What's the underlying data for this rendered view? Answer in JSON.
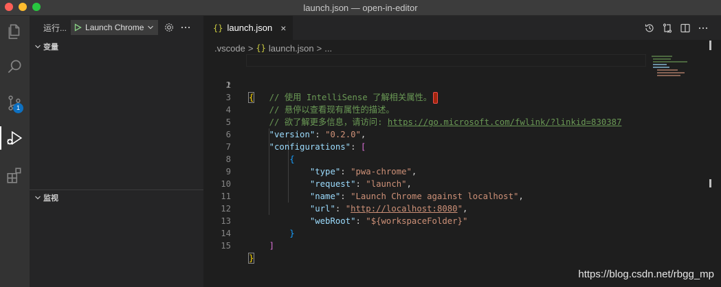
{
  "window": {
    "title": "launch.json — open-in-editor",
    "traffic_colors": [
      "#fe5f57",
      "#febc2e",
      "#28c840"
    ]
  },
  "activity_bar": {
    "badge_count": "1",
    "icons": [
      "files-icon",
      "search-icon",
      "source-control-icon",
      "run-debug-icon",
      "extensions-icon"
    ]
  },
  "sidebar": {
    "run_label": "运行...",
    "config_name": "Launch Chrome",
    "sections": {
      "variables": "变量",
      "watch": "监视"
    }
  },
  "editor": {
    "tab": {
      "icon_text": "{}",
      "label": "launch.json",
      "close": "×"
    },
    "breadcrumb": {
      "folder": ".vscode",
      "sep": ">",
      "file_icon": "{}",
      "file": "launch.json",
      "tail": "..."
    },
    "line_numbers": [
      "1",
      "2",
      "3",
      "4",
      "5",
      "6",
      "7",
      "8",
      "9",
      "10",
      "11",
      "12",
      "13",
      "14",
      "15"
    ],
    "code": {
      "l1_open": "{",
      "l2_comment": "// 使用 IntelliSense 了解相关属性。",
      "l3_comment": "// 悬停以查看现有属性的描述。",
      "l4_comment": "// 欲了解更多信息，请访问: ",
      "l4_link": "https://go.microsoft.com/fwlink/?linkid=830387",
      "version_key": "\"version\"",
      "version_val": "\"0.2.0\"",
      "configurations_key": "\"configurations\"",
      "arr_open": "[",
      "obj_open": "{",
      "type_key": "\"type\"",
      "type_val": "\"pwa-chrome\"",
      "request_key": "\"request\"",
      "request_val": "\"launch\"",
      "name_key": "\"name\"",
      "name_val": "\"Launch Chrome against localhost\"",
      "url_key": "\"url\"",
      "url_q": "\"",
      "url_val": "http://localhost:8080",
      "webroot_key": "\"webRoot\"",
      "webroot_val": "\"${workspaceFolder}\"",
      "obj_close": "}",
      "arr_close": "]",
      "l15_close": "}",
      "colon": ": ",
      "comma": ","
    }
  },
  "watermark": "https://blog.csdn.net/rbgg_mp",
  "colors": {
    "accent_badge": "#0e70c0",
    "comment": "#6a9955",
    "key": "#9cdcfe",
    "string": "#ce9178",
    "bracket_yellow": "#ffd700",
    "bracket_purple": "#da70d6",
    "bracket_blue": "#179fff"
  }
}
